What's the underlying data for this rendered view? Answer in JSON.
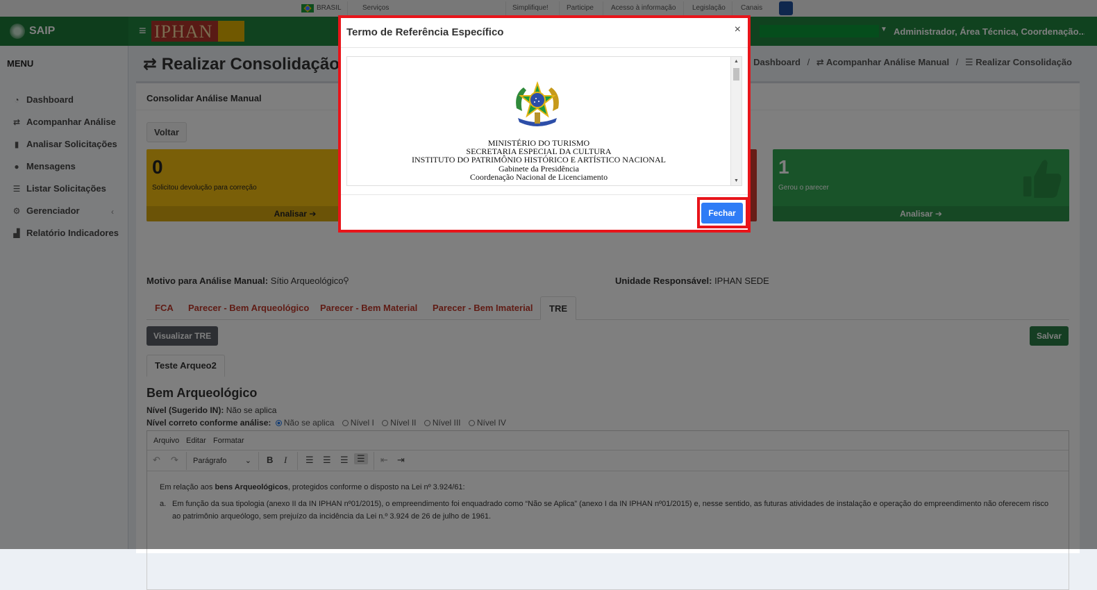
{
  "govbar": {
    "brasil": "BRASIL",
    "servicos": "Serviços",
    "links": [
      "Simplifique!",
      "Participe",
      "Acesso à informação",
      "Legislação",
      "Canais"
    ]
  },
  "header": {
    "brand": "SAIP",
    "hamburger": "≡",
    "iphan": "IPHAN",
    "user": "Administrador, Área Técnica, Coordenação..."
  },
  "sidebar": {
    "title": "MENU",
    "items": [
      {
        "label": "Dashboard",
        "icon": "dashboard-icon"
      },
      {
        "label": "Acompanhar Análise",
        "icon": "exchange-icon"
      },
      {
        "label": "Analisar Solicitações",
        "icon": "book-icon"
      },
      {
        "label": "Mensagens",
        "icon": "comments-icon"
      },
      {
        "label": "Listar Solicitações",
        "icon": "list-icon"
      },
      {
        "label": "Gerenciador",
        "icon": "cogs-icon"
      },
      {
        "label": "Relatório Indicadores",
        "icon": "chart-icon"
      }
    ]
  },
  "page": {
    "title": "Realizar Consolidação d",
    "breadcrumb": [
      "Dashboard",
      "Acompanhar Análise Manual",
      "Realizar Consolidação"
    ]
  },
  "box": {
    "title": "Consolidar Análise Manual",
    "voltar": "Voltar",
    "cards": [
      {
        "count": "0",
        "label": "Solicitou devolução para correção",
        "action": "Analisar",
        "color": "#f5be10"
      },
      {
        "count": "1",
        "label": "Gerou o parecer",
        "action": "Analisar",
        "color": "#33a652"
      }
    ],
    "motivo_label": "Motivo para Análise Manual:",
    "motivo_value": "Sítio Arqueológico",
    "unidade_label": "Unidade Responsável:",
    "unidade_value": "IPHAN SEDE",
    "tabs": [
      "FCA",
      "Parecer - Bem Arqueológico",
      "Parecer - Bem Material",
      "Parecer - Bem Imaterial",
      "TRE"
    ],
    "visualizar": "Visualizar TRE",
    "salvar": "Salvar",
    "subtab": "Teste Arqueo2",
    "bem_title": "Bem Arqueológico",
    "nivel_sugerido_label": "Nível (Sugerido IN):",
    "nivel_sugerido_value": "Não se aplica",
    "nivel_correto_label": "Nível correto conforme análise:",
    "nivel_options": [
      "Não se aplica",
      "Nível I",
      "Nível II",
      "Nível III",
      "Nível IV"
    ],
    "nivel_selected": "Não se aplica"
  },
  "editor": {
    "menu": [
      "Arquivo",
      "Editar",
      "Formatar"
    ],
    "format_select": "Parágrafo",
    "p1_pre": "Em relação aos ",
    "p1_bold": "bens Arqueológicos",
    "p1_post": ", protegidos conforme o disposto na Lei nº 3.924/61:",
    "li_marker": "a.",
    "li_text": "Em função da sua tipologia (anexo II da IN IPHAN nº01/2015), o empreendimento foi enquadrado como “Não se Aplica” (anexo I da IN IPHAN nº01/2015) e, nesse sentido, as futuras atividades de instalação e operação do empreendimento não oferecem risco ao patrimônio arqueólogo, sem prejuízo da incidência da Lei n.º 3.924 de 26 de julho de 1961."
  },
  "modal": {
    "title": "Termo de Referência Específico",
    "close": "×",
    "doc_lines": [
      "MINISTÉRIO DO TURISMO",
      "SECRETARIA ESPECIAL DA CULTURA",
      "INSTITUTO DO PATRIMÔNIO HISTÓRICO E ARTÍSTICO NACIONAL",
      "Gabinete da Presidência",
      "Coordenação Nacional de Licenciamento"
    ],
    "fechar": "Fechar"
  },
  "colors": {
    "header_green": "#20843f",
    "highlight_red": "#e8141a",
    "primary_blue": "#2f7cf6",
    "tab_red": "#c0392b"
  }
}
